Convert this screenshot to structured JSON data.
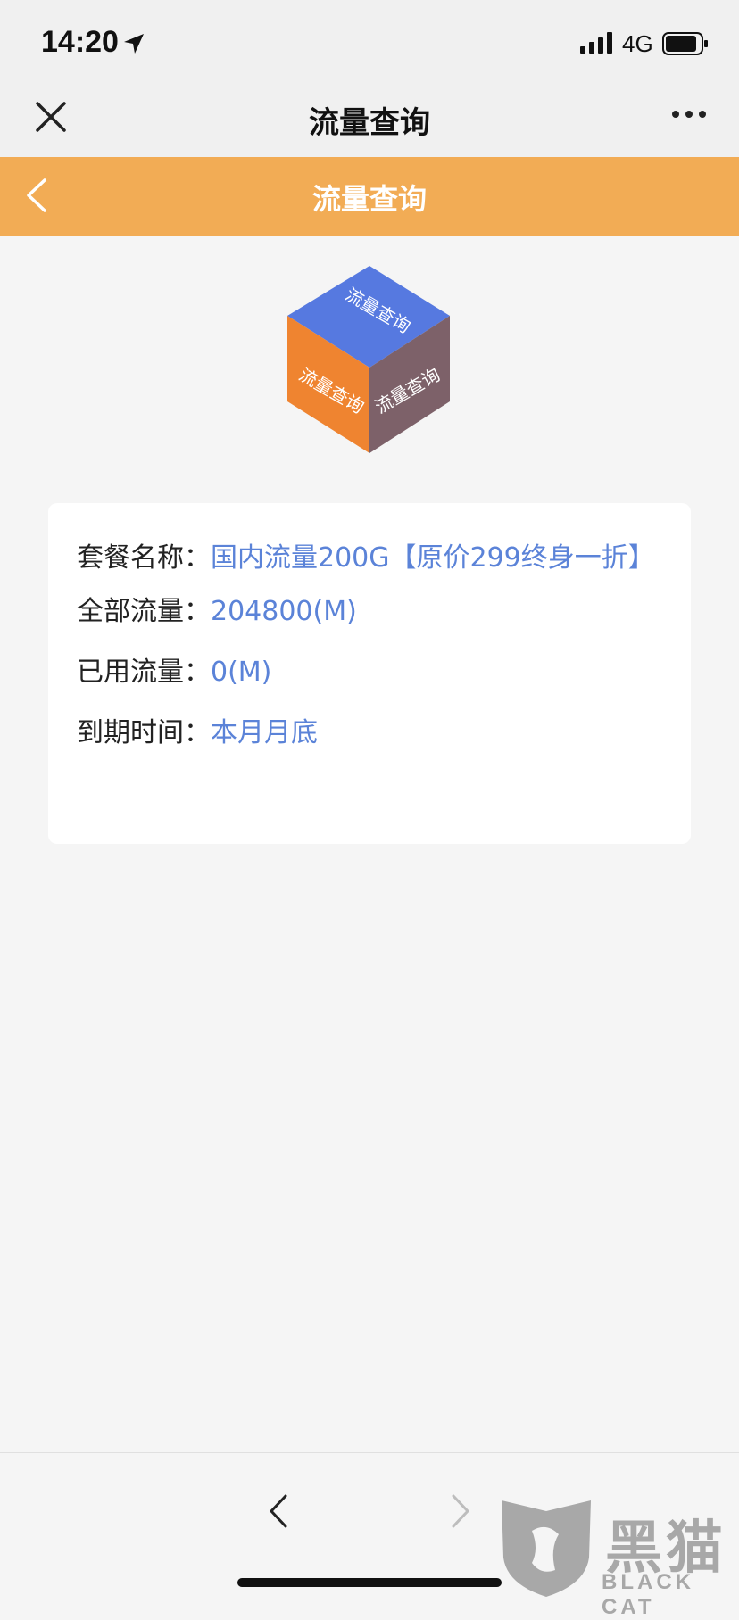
{
  "status_bar": {
    "time": "14:20",
    "network": "4G",
    "icons": [
      "location-arrow-icon",
      "signal-icon",
      "battery-icon"
    ]
  },
  "wechat_nav": {
    "title": "流量查询",
    "icons": [
      "close-icon",
      "more-icon"
    ]
  },
  "page_header": {
    "title": "流量查询",
    "icons": [
      "back-chevron-icon"
    ],
    "color": "#f2ac55"
  },
  "logo": {
    "top_text": "流量查询",
    "left_text": "流量查询",
    "right_text": "流量查询",
    "colors": {
      "top": "#5679e0",
      "left": "#ef8430",
      "right": "#7d6169"
    }
  },
  "info": {
    "plan_label": "套餐名称：",
    "plan_value": "国内流量200G【原价299终身一折】",
    "total_label": "全部流量：",
    "total_value": "204800(M)",
    "used_label": "已用流量：",
    "used_value": "0(M)",
    "expiry_label": "到期时间：",
    "expiry_value": "本月月底",
    "value_color": "#5b83d8"
  },
  "bottom_nav": {
    "icons": [
      "nav-back-icon",
      "nav-forward-icon"
    ]
  },
  "watermark": {
    "cn": "黑猫",
    "en": "BLACK CAT"
  }
}
